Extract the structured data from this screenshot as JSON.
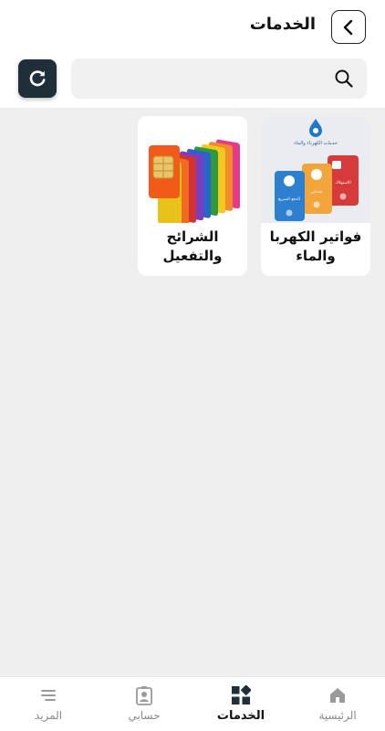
{
  "header": {
    "title": "الخدمات"
  },
  "search": {
    "placeholder": "",
    "value": ""
  },
  "cards": [
    {
      "label": "فواتير الكهربا والماء",
      "image_caption": "خدمات الكهرباء والماء",
      "image_items": [
        "الدفع السريع",
        "عدداتي",
        "الاستهلاك"
      ]
    },
    {
      "label": "الشرائح والتفعيل"
    }
  ],
  "nav": {
    "home": "الرئيسية",
    "services": "الخدمات",
    "account": "حسابي",
    "more": "المزيد",
    "active": "services"
  },
  "colors": {
    "accent": "#1f2f3a",
    "content_bg": "#efefef",
    "search_bg": "#f0f0f0",
    "inactive_nav": "#8a8a8a"
  },
  "icons": {
    "back": "chevron-left-icon",
    "search": "search-icon",
    "refresh": "refresh-icon",
    "home": "home-icon",
    "services": "grid-icon",
    "account": "profile-icon",
    "more": "menu-lines-icon"
  }
}
